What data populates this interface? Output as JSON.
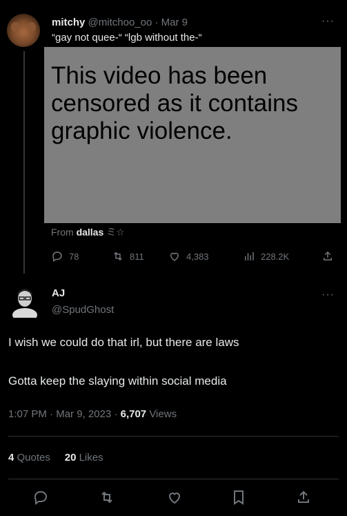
{
  "tweet1": {
    "name": "mitchy",
    "handle": "@mitchoo_oo",
    "separator": "·",
    "date": "Mar 9",
    "text": "“gay not quee-“ “lgb without the-“",
    "media_overlay": "This video has been censored as it contains graphic violence.",
    "from_prefix": "From",
    "from_name": "dallas",
    "from_emoji": "ミ☆",
    "more": "···",
    "stats": {
      "replies": "78",
      "retweets": "811",
      "likes": "4,383",
      "views": "228.2K"
    }
  },
  "tweet2": {
    "name": "AJ",
    "handle": "@SpudGhost",
    "more": "···",
    "line1": "I wish we could do that irl, but there are laws",
    "line2": "Gotta keep the slaying within social media",
    "time": "1:07 PM",
    "separator": "·",
    "date": "Mar 9, 2023",
    "views_count": "6,707",
    "views_label": "Views",
    "quotes_count": "4",
    "quotes_label": "Quotes",
    "likes_count": "20",
    "likes_label": "Likes"
  },
  "colors": {
    "background": "#000000",
    "text": "#e7e9ea",
    "muted": "#71767b",
    "media_gray": "#7f7f7f",
    "divider": "#2f3336"
  },
  "icons": [
    "reply-icon",
    "retweet-icon",
    "like-icon",
    "views-icon",
    "share-icon",
    "bookmark-icon",
    "more-icon"
  ]
}
